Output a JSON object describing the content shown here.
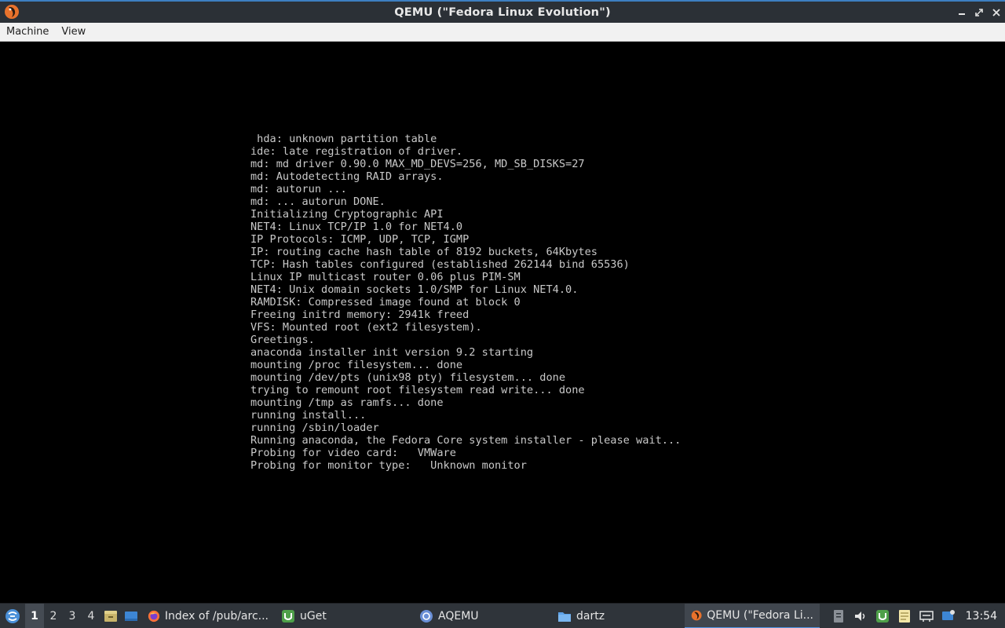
{
  "window": {
    "title": "QEMU (\"Fedora Linux Evolution\")",
    "icon": "qemu-icon"
  },
  "menubar": {
    "items": [
      {
        "label": "Machine"
      },
      {
        "label": "View"
      }
    ]
  },
  "console": {
    "lines": [
      " hda: unknown partition table",
      "ide: late registration of driver.",
      "md: md driver 0.90.0 MAX_MD_DEVS=256, MD_SB_DISKS=27",
      "md: Autodetecting RAID arrays.",
      "md: autorun ...",
      "md: ... autorun DONE.",
      "Initializing Cryptographic API",
      "NET4: Linux TCP/IP 1.0 for NET4.0",
      "IP Protocols: ICMP, UDP, TCP, IGMP",
      "IP: routing cache hash table of 8192 buckets, 64Kbytes",
      "TCP: Hash tables configured (established 262144 bind 65536)",
      "Linux IP multicast router 0.06 plus PIM-SM",
      "NET4: Unix domain sockets 1.0/SMP for Linux NET4.0.",
      "RAMDISK: Compressed image found at block 0",
      "Freeing initrd memory: 2941k freed",
      "VFS: Mounted root (ext2 filesystem).",
      "Greetings.",
      "anaconda installer init version 9.2 starting",
      "mounting /proc filesystem... done",
      "mounting /dev/pts (unix98 pty) filesystem... done",
      "trying to remount root filesystem read write... done",
      "mounting /tmp as ramfs... done",
      "running install...",
      "running /sbin/loader",
      "Running anaconda, the Fedora Core system installer - please wait...",
      "Probing for video card:   VMWare",
      "Probing for monitor type:   Unknown monitor"
    ]
  },
  "taskbar": {
    "desktops": [
      "1",
      "2",
      "3",
      "4"
    ],
    "active_desktop": "1",
    "tasks": [
      {
        "label": "Index of /pub/arc...",
        "icon": "firefox-icon"
      },
      {
        "label": "uGet",
        "icon": "uget-icon"
      },
      {
        "label": "AQEMU",
        "icon": "aqemu-icon"
      },
      {
        "label": "dartz",
        "icon": "folder-icon"
      },
      {
        "label": "QEMU (\"Fedora Li...",
        "icon": "qemu-icon",
        "active": true
      }
    ],
    "clock": "13:54"
  },
  "colors": {
    "titlebar_bg": "#2b3036",
    "accent": "#3d7fc1",
    "console_text": "#c9c9c9",
    "taskbar_bg": "#2f343a"
  }
}
